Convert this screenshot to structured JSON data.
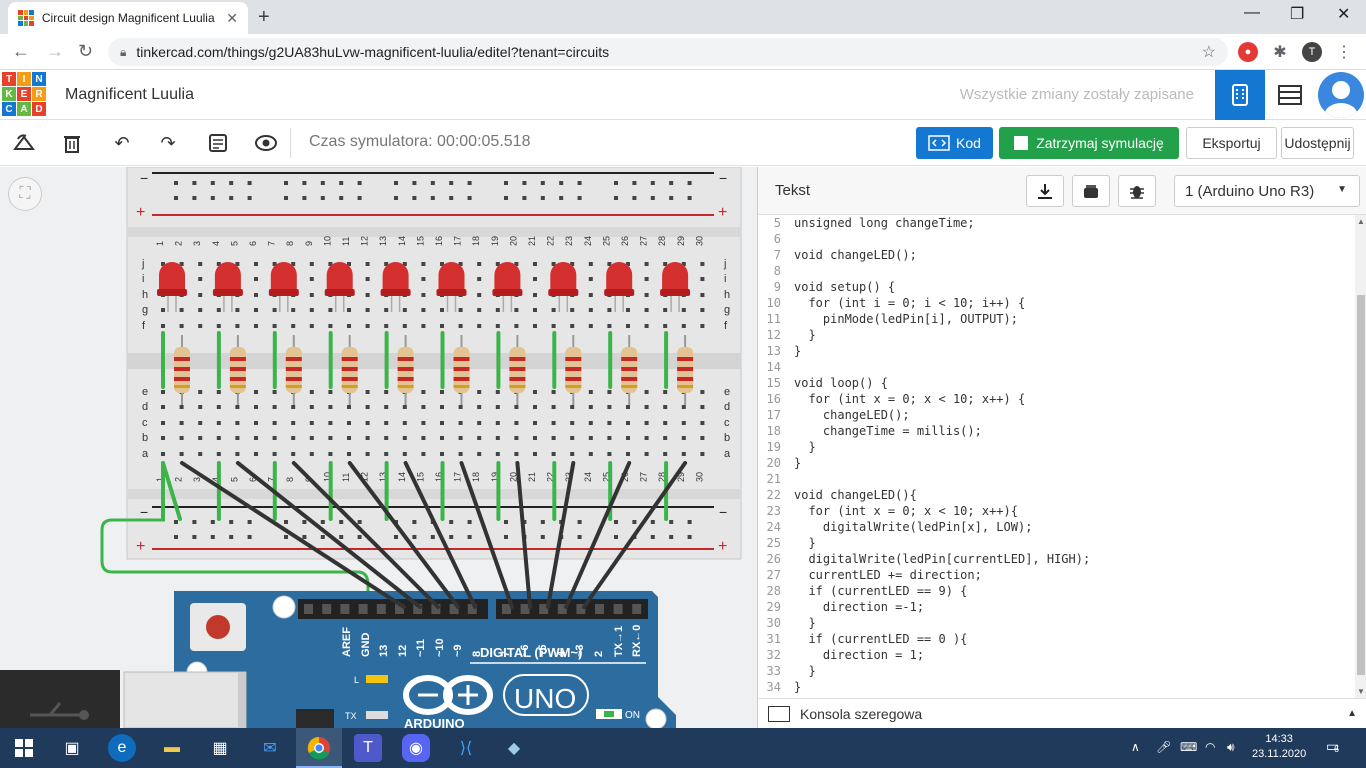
{
  "browser": {
    "tab_title": "Circuit design Magnificent Luulia",
    "url": "tinkercad.com/things/g2UA83huLvw-magnificent-luulia/editel?tenant=circuits",
    "profile_initial": "T"
  },
  "header": {
    "logo_letters": [
      "T",
      "I",
      "N",
      "K",
      "E",
      "R",
      "C",
      "A",
      "D"
    ],
    "project_name": "Magnificent Luulia",
    "save_status": "Wszystkie zmiany zostały zapisane"
  },
  "toolbar": {
    "sim_time": "Czas symulatora: 00:00:05.518",
    "code_label": "Kod",
    "stop_label": "Zatrzymaj symulację",
    "export_label": "Eksportuj",
    "share_label": "Udostępnij"
  },
  "breadboard": {
    "column_numbers": [
      "1",
      "2",
      "3",
      "4",
      "5",
      "6",
      "7",
      "8",
      "9",
      "10",
      "11",
      "12",
      "13",
      "14",
      "15",
      "16",
      "17",
      "18",
      "19",
      "20",
      "21",
      "22",
      "23",
      "24",
      "25",
      "26",
      "27",
      "28",
      "29",
      "30"
    ],
    "row_letters_top": [
      "j",
      "i",
      "h",
      "g",
      "f"
    ],
    "row_letters_bottom": [
      "e",
      "d",
      "c",
      "b",
      "a"
    ],
    "rail_minus": "−",
    "rail_plus": "+"
  },
  "arduino": {
    "pin_labels": [
      "AREF",
      "GND",
      "13",
      "12",
      "~11",
      "~10",
      "~9",
      "8",
      "7",
      "~6",
      "~5",
      "4",
      "~3",
      "2",
      "TX→1",
      "RX←0"
    ],
    "digital_label": "DIGITAL (PWM~)",
    "uno_label": "UNO",
    "brand": "ARDUINO",
    "led_l": "L",
    "led_tx": "TX",
    "on_label": "ON"
  },
  "code_panel": {
    "mode": "Tekst",
    "device": "1 (Arduino Uno R3)",
    "serial_label": "Konsola szeregowa",
    "lines": [
      {
        "n": "5",
        "t": "unsigned long changeTime;"
      },
      {
        "n": "6",
        "t": ""
      },
      {
        "n": "7",
        "t": "void changeLED();"
      },
      {
        "n": "8",
        "t": ""
      },
      {
        "n": "9",
        "t": "void setup() {"
      },
      {
        "n": "10",
        "t": "  for (int i = 0; i < 10; i++) {"
      },
      {
        "n": "11",
        "t": "    pinMode(ledPin[i], OUTPUT);"
      },
      {
        "n": "12",
        "t": "  }"
      },
      {
        "n": "13",
        "t": "}"
      },
      {
        "n": "14",
        "t": ""
      },
      {
        "n": "15",
        "t": "void loop() {"
      },
      {
        "n": "16",
        "t": "  for (int x = 0; x < 10; x++) {"
      },
      {
        "n": "17",
        "t": "    changeLED();"
      },
      {
        "n": "18",
        "t": "    changeTime = millis();"
      },
      {
        "n": "19",
        "t": "  }"
      },
      {
        "n": "20",
        "t": "}"
      },
      {
        "n": "21",
        "t": ""
      },
      {
        "n": "22",
        "t": "void changeLED(){"
      },
      {
        "n": "23",
        "t": "  for (int x = 0; x < 10; x++){"
      },
      {
        "n": "24",
        "t": "    digitalWrite(ledPin[x], LOW);"
      },
      {
        "n": "25",
        "t": "  }"
      },
      {
        "n": "26",
        "t": "  digitalWrite(ledPin[currentLED], HIGH);"
      },
      {
        "n": "27",
        "t": "  currentLED += direction;"
      },
      {
        "n": "28",
        "t": "  if (currentLED == 9) {"
      },
      {
        "n": "29",
        "t": "    direction =-1;"
      },
      {
        "n": "30",
        "t": "  }"
      },
      {
        "n": "31",
        "t": "  if (currentLED == 0 ){"
      },
      {
        "n": "32",
        "t": "    direction = 1;"
      },
      {
        "n": "33",
        "t": "  }"
      },
      {
        "n": "34",
        "t": "}"
      }
    ]
  },
  "taskbar": {
    "time": "14:33",
    "date": "23.11.2020",
    "notifications": "6"
  },
  "colors": {
    "tinkercad_blue": "#1477d1",
    "sim_green": "#23a04a",
    "led_red": "#d32f2f",
    "wire_green": "#3bb54a",
    "wire_black": "#333333",
    "arduino_blue": "#2d6c9f"
  }
}
